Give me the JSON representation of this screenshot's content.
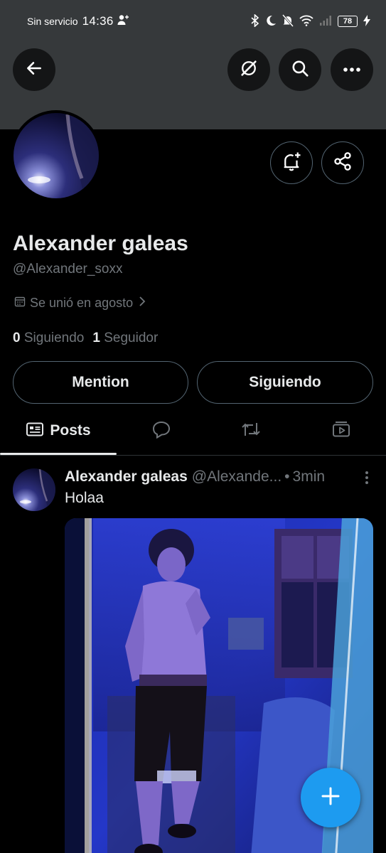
{
  "status_bar": {
    "carrier": "Sin servicio",
    "time": "14:36",
    "battery": "78"
  },
  "profile": {
    "name": "Alexander galeas",
    "handle": "@Alexander_soxx",
    "joined": "Se unió en agosto",
    "following_count": "0",
    "following_label": "Siguiendo",
    "followers_count": "1",
    "followers_label": "Seguidor"
  },
  "actions": {
    "mention_label": "Mention",
    "following_button_label": "Siguiendo"
  },
  "tabs": [
    {
      "label": "Posts",
      "icon": "posts-icon",
      "active": true
    },
    {
      "label": "",
      "icon": "replies-icon",
      "active": false
    },
    {
      "label": "",
      "icon": "reposts-icon",
      "active": false
    },
    {
      "label": "",
      "icon": "media-icon",
      "active": false
    }
  ],
  "post": {
    "author_name": "Alexander galeas",
    "author_handle": "@Alexande...",
    "separator": "•",
    "time": "3min",
    "text": "Holaa"
  },
  "colors": {
    "accent": "#1d9bf0",
    "background": "#000000",
    "banner": "#36393b",
    "secondary_text": "#71767b",
    "border": "#536471"
  }
}
